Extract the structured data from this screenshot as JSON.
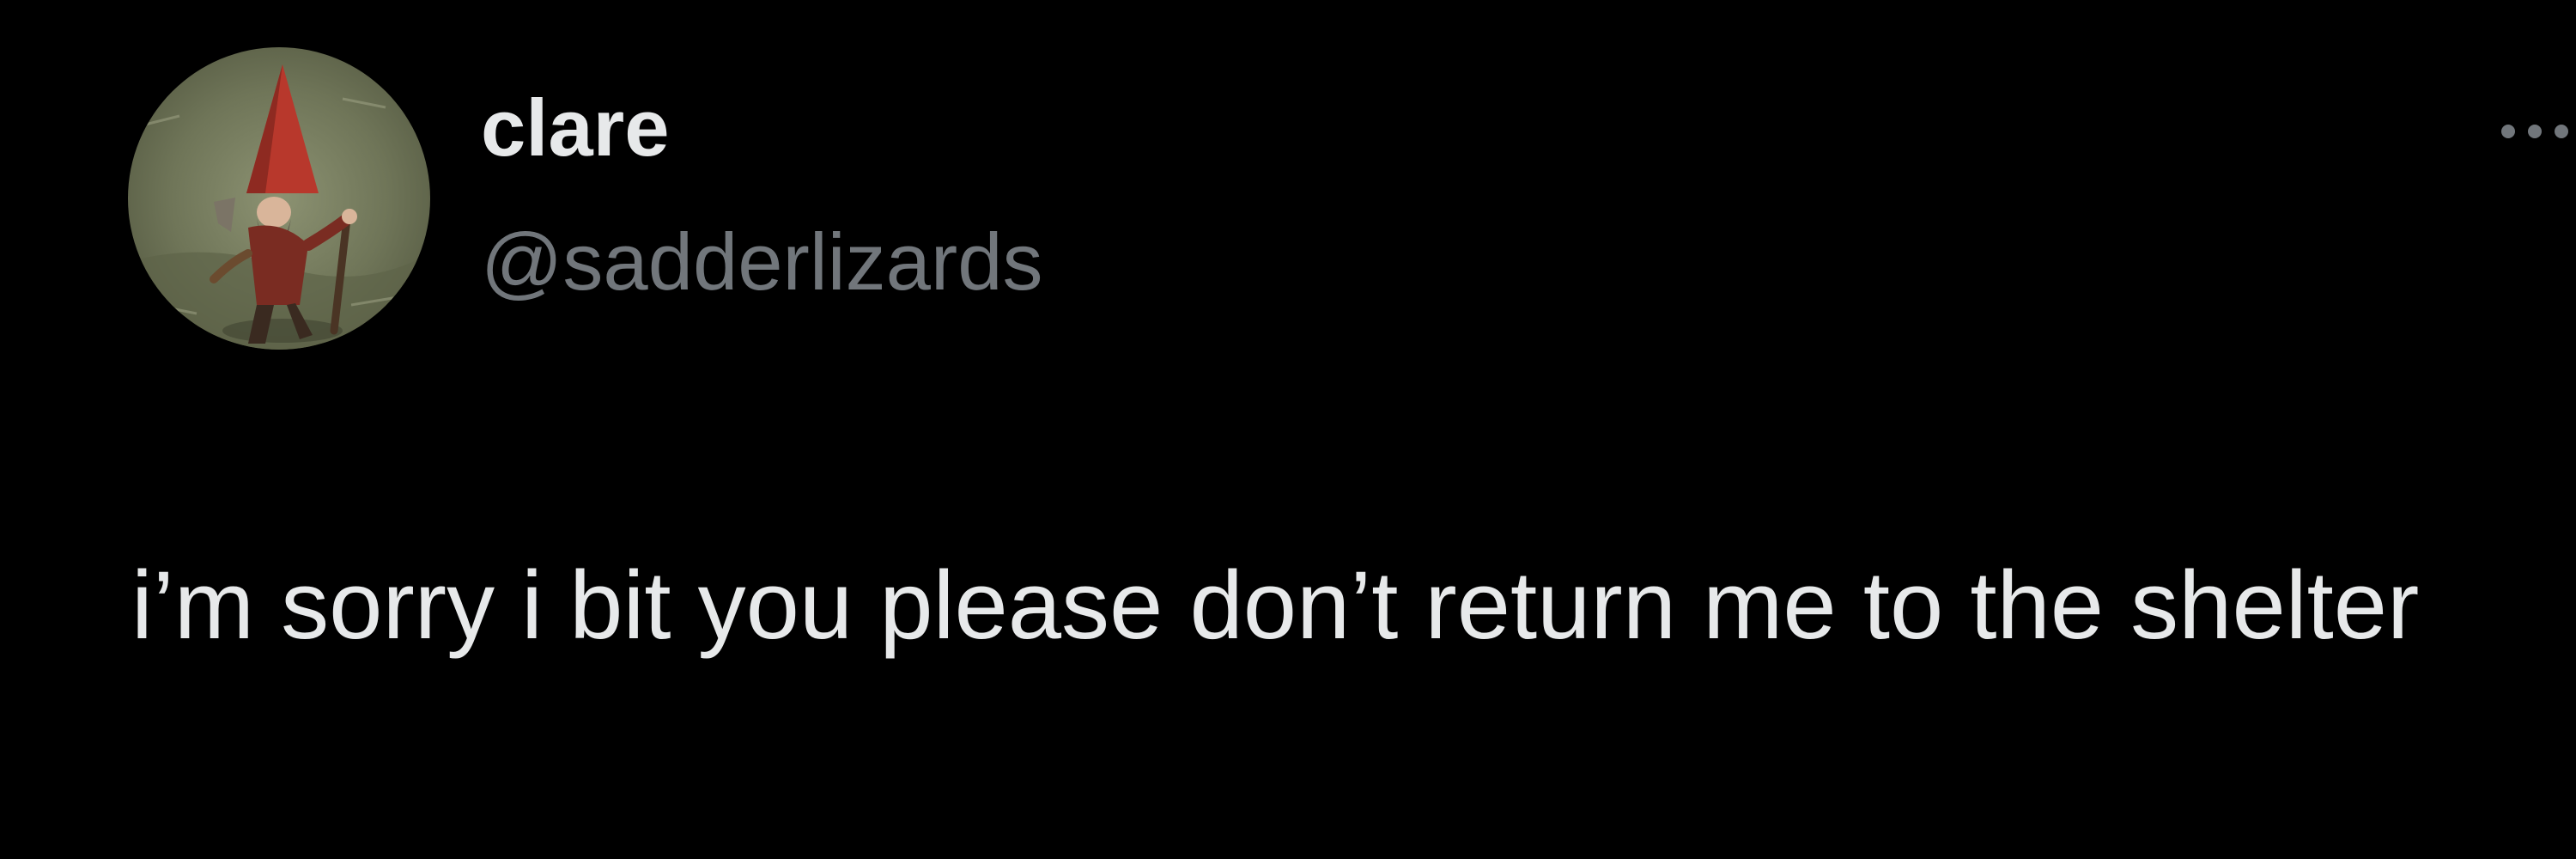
{
  "author": {
    "display_name": "clare",
    "handle": "@sadderlizards",
    "avatar_icon": "gnome-avatar-icon"
  },
  "actions": {
    "more_icon": "more-horizontal-icon"
  },
  "tweet": {
    "text": "i’m sorry i bit you please don’t return me to the shelter"
  },
  "colors": {
    "background": "#000000",
    "primary_text": "#e7e9ea",
    "secondary_text": "#71767b"
  }
}
